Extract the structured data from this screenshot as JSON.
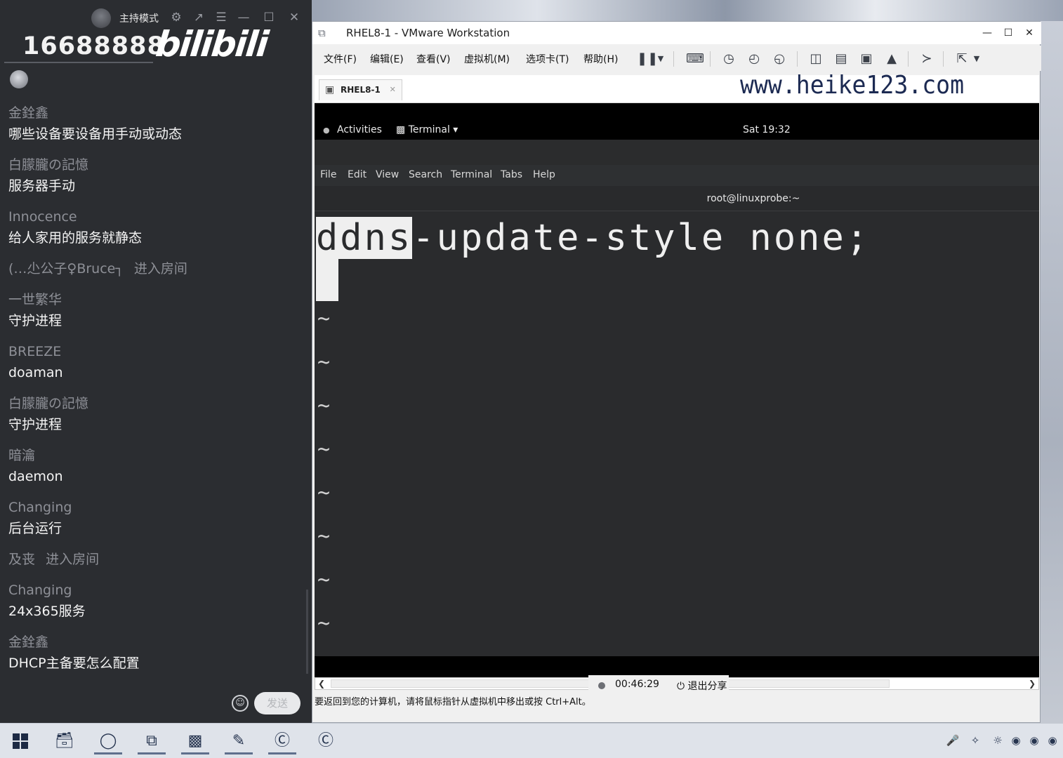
{
  "chat": {
    "host_mode": "主持模式",
    "room_number": "16688888",
    "logo_text": "bilibili",
    "messages": [
      {
        "name": "金銓鑫",
        "text": "哪些设备要设备用手动或动态"
      },
      {
        "name": "白朦朧の記憶",
        "text": "服务器手动"
      },
      {
        "name": "Innocence",
        "text": "给人家用的服务就静态"
      },
      {
        "name": "(…尐公子♀Bruce┐",
        "action": "进入房间"
      },
      {
        "name": "一世繁华",
        "text": "守护进程"
      },
      {
        "name": "BREEZE",
        "text": "doaman"
      },
      {
        "name": "白朦朧の記憶",
        "text": "守护进程"
      },
      {
        "name": "暗瀹",
        "text": "daemon"
      },
      {
        "name": "Changing",
        "text": "后台运行"
      },
      {
        "name": "及丧",
        "action": "进入房间"
      },
      {
        "name": "Changing",
        "text": "24x365服务"
      },
      {
        "name": "金銓鑫",
        "text": "DHCP主备要怎么配置"
      }
    ],
    "send_label": "发送"
  },
  "vmware": {
    "title": "RHEL8-1 - VMware Workstation",
    "menu": [
      "文件(F)",
      "编辑(E)",
      "查看(V)",
      "虚拟机(M)",
      "选项卡(T)",
      "帮助(H)"
    ],
    "tab_label": "RHEL8-1",
    "watermark": "www.heike123.com",
    "status_text": "要返回到您的计算机，请将鼠标指针从虚拟机中移出或按 Ctrl+Alt。",
    "record_time": "00:46:29",
    "exit_share": "退出分享"
  },
  "guest": {
    "activities": "Activities",
    "app_menu": "Terminal ▾",
    "clock": "Sat 19:32",
    "terminal_menu": [
      "File",
      "Edit",
      "View",
      "Search",
      "Terminal",
      "Tabs",
      "Help"
    ],
    "terminal_title": "root@linuxprobe:~",
    "vim_highlight": "ddns",
    "vim_rest": "-update-style none;",
    "tilde": "~"
  },
  "colors": {
    "chat_bg": "#2b2d31",
    "terminal_bg": "#2a2b2d",
    "terminal_fg": "#efefef",
    "watermark": "#1c2a52"
  }
}
